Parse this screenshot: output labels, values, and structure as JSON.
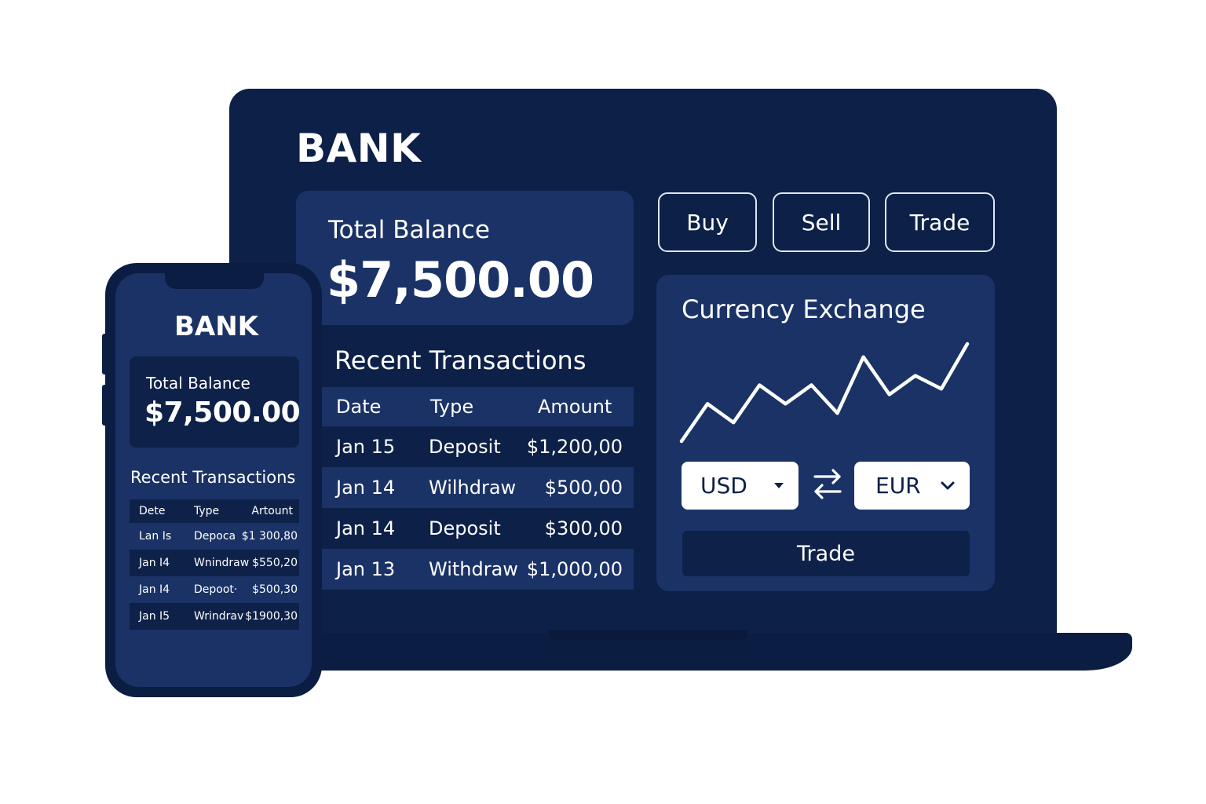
{
  "laptop": {
    "title": "BANK",
    "balance": {
      "label": "Total Balance",
      "value": "$7,500.00"
    },
    "actions": {
      "buy": "Buy",
      "sell": "Sell",
      "trade": "Trade"
    },
    "transactions": {
      "heading": "Recent Transactions",
      "columns": [
        "Date",
        "Type",
        "Amount"
      ],
      "rows": [
        {
          "date": "Jan 15",
          "type": "Deposit",
          "amount": "$1,200,00"
        },
        {
          "date": "Jan 14",
          "type": "Wilhdraw",
          "amount": "$500,00"
        },
        {
          "date": "Jan 14",
          "type": "Deposit",
          "amount": "$300,00"
        },
        {
          "date": "Jan 13",
          "type": "Withdraw",
          "amount": "$1,000,00"
        }
      ]
    },
    "exchange": {
      "heading": "Currency Exchange",
      "from": "USD",
      "to": "EUR",
      "submit": "Trade",
      "chart_data": {
        "type": "line",
        "series": [
          {
            "values": [
              1,
              3,
              2,
              4,
              3,
              4,
              2.5,
              5.5,
              3.5,
              4.5,
              3.8,
              6.2
            ]
          }
        ],
        "color": "#ffffff"
      }
    }
  },
  "phone": {
    "title": "BANK",
    "balance": {
      "label": "Total Balance",
      "value": "$7,500.00"
    },
    "transactions": {
      "heading": "Recent Transactions",
      "columns": [
        "Dete",
        "Type",
        "Artount"
      ],
      "rows": [
        {
          "date": "Lan Is",
          "type": "Depoca",
          "amount": "$1 300,80"
        },
        {
          "date": "Jan I4",
          "type": "Wnindraw",
          "amount": "$550,20"
        },
        {
          "date": "Jan I4",
          "type": "Depoot·",
          "amount": "$500,30"
        },
        {
          "date": "Jan I5",
          "type": "Wrindrav",
          "amount": "$1900,30"
        }
      ]
    }
  },
  "colors": {
    "navy": "#0d2047",
    "card": "#1a3265",
    "dark": "#0e2149",
    "text": "#ffffff"
  }
}
